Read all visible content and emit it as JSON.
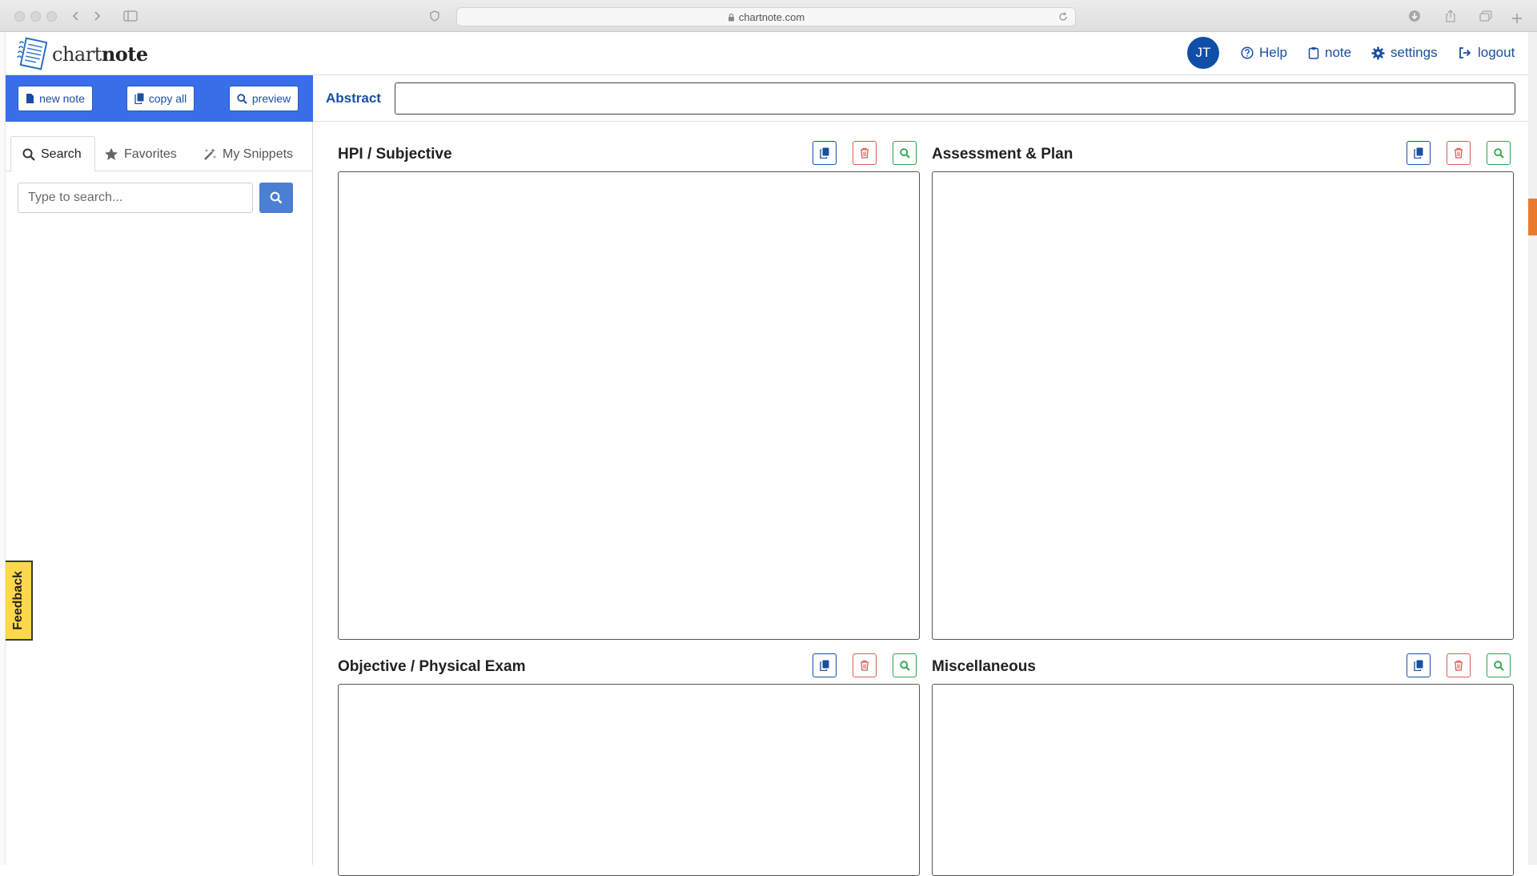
{
  "browser": {
    "url": "chartnote.com"
  },
  "brand": {
    "logo_light": "chart",
    "logo_bold": "note"
  },
  "topnav": {
    "avatar_initials": "JT",
    "help": "Help",
    "note": "note",
    "settings": "settings",
    "logout": "logout"
  },
  "toolbar": {
    "new_note": "new note",
    "copy_all": "copy all",
    "preview": "preview"
  },
  "sidebar": {
    "tabs": [
      {
        "label": "Search",
        "icon": "search-icon",
        "active": true
      },
      {
        "label": "Favorites",
        "icon": "star-icon",
        "active": false
      },
      {
        "label": "My Snippets",
        "icon": "magic-wand-icon",
        "active": false
      }
    ],
    "search_placeholder": "Type to search...",
    "search_value": ""
  },
  "feedback": {
    "label": "Feedback"
  },
  "abstract": {
    "label": "Abstract",
    "value": ""
  },
  "sections": [
    {
      "title": "HPI / Subjective",
      "content": ""
    },
    {
      "title": "Assessment & Plan",
      "content": ""
    },
    {
      "title": "Objective / Physical Exam",
      "content": ""
    },
    {
      "title": "Miscellaneous",
      "content": ""
    }
  ],
  "colors": {
    "primary": "#1a4fa0",
    "toolbar_blue": "#3a6ee8",
    "avatar_blue": "#0f4fa8",
    "danger": "#e05a5a",
    "success": "#2aa64a",
    "feedback_yellow": "#ffd84a"
  }
}
